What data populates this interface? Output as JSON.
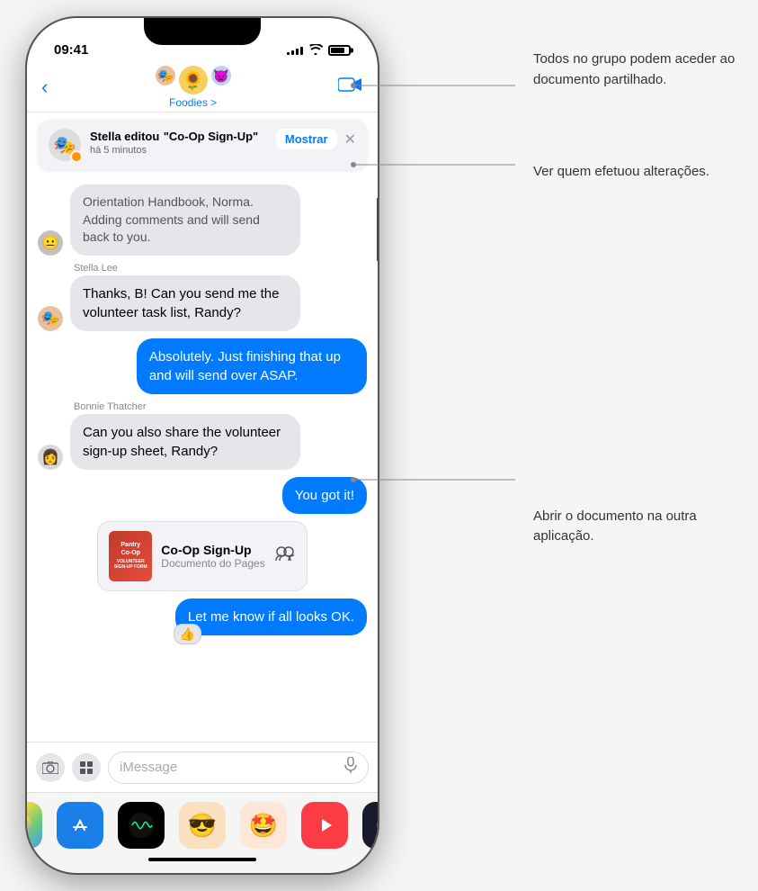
{
  "status": {
    "time": "09:41",
    "signal": [
      3,
      5,
      7,
      9,
      11
    ],
    "wifi": "●●●",
    "battery": 80
  },
  "nav": {
    "back_label": "‹",
    "group_name": "Foodies >",
    "video_icon": "📹",
    "avatars": [
      "🎭",
      "🌻",
      "👿"
    ]
  },
  "notification": {
    "title": "Stella editou",
    "subtitle": "\"Co-Op Sign-Up\"",
    "time": "há 5 minutos",
    "show_btn": "Mostrar",
    "close_btn": "✕",
    "avatar_emoji": "🎭"
  },
  "messages": [
    {
      "id": "msg1",
      "sender": "",
      "text": "Orientation Handbook, Norma. Adding comments and will send back to you.",
      "type": "incoming",
      "avatar": "😐"
    },
    {
      "id": "msg2",
      "sender": "Stella Lee",
      "text": "Thanks, B! Can you send me the volunteer task list, Randy?",
      "type": "incoming",
      "avatar": "🎭"
    },
    {
      "id": "msg3",
      "sender": "",
      "text": "Absolutely. Just finishing that up and will send over ASAP.",
      "type": "outgoing",
      "avatar": ""
    },
    {
      "id": "msg4",
      "sender": "Bonnie Thatcher",
      "text": "Can you also share the volunteer sign-up sheet, Randy?",
      "type": "incoming",
      "avatar": "👩"
    },
    {
      "id": "msg5",
      "sender": "",
      "text": "You got it!",
      "type": "outgoing",
      "avatar": ""
    },
    {
      "id": "msg6",
      "sender": "",
      "type": "document",
      "doc_name": "Co-Op Sign-Up",
      "doc_type": "Documento do Pages",
      "doc_thumbnail": "Pantry\nCo-Op"
    },
    {
      "id": "msg7",
      "sender": "",
      "text": "Let me know if all looks OK.",
      "type": "outgoing",
      "reaction": "👍"
    }
  ],
  "input": {
    "placeholder": "iMessage",
    "camera_icon": "📷",
    "apps_icon": "⊞",
    "mic_icon": "🎤"
  },
  "dock": [
    {
      "name": "Photos",
      "emoji": "🌅",
      "bg": "#f5f5f5"
    },
    {
      "name": "App Store",
      "emoji": "📱",
      "bg": "#1a7fe8"
    },
    {
      "name": "Voice",
      "emoji": "🎵",
      "bg": "#000"
    },
    {
      "name": "Memoji1",
      "emoji": "😎",
      "bg": "#f9e0c0"
    },
    {
      "name": "Memoji2",
      "emoji": "🤩",
      "bg": "#fde8d8"
    },
    {
      "name": "Music",
      "emoji": "🎵",
      "bg": "#fc3c44"
    },
    {
      "name": "Fitness",
      "emoji": "⭕",
      "bg": "#000"
    }
  ],
  "annotations": [
    {
      "id": "ann1",
      "text": "Todos no grupo podem\naceder ao documento\npartilhado."
    },
    {
      "id": "ann2",
      "text": "Ver quem efetuou\nalterações."
    },
    {
      "id": "ann3",
      "text": "Abrir o documento\nna outra aplicação."
    }
  ]
}
